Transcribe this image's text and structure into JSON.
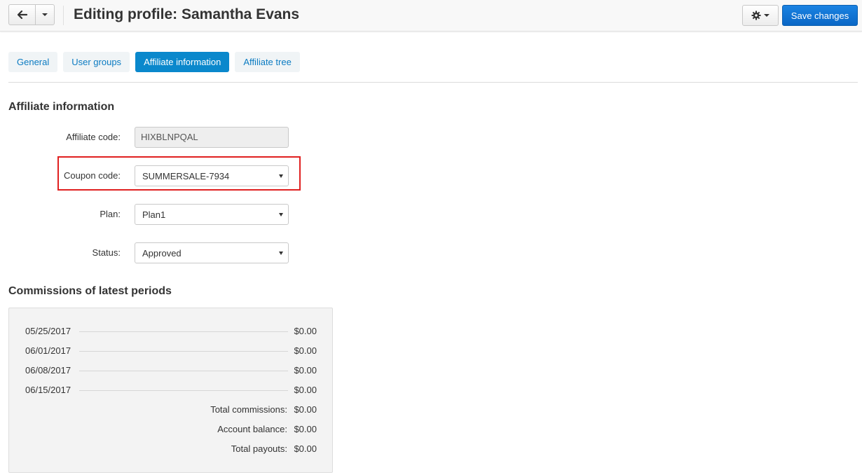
{
  "header": {
    "title": "Editing profile: Samantha Evans",
    "save_label": "Save changes"
  },
  "tabs": [
    {
      "label": "General",
      "active": false
    },
    {
      "label": "User groups",
      "active": false
    },
    {
      "label": "Affiliate information",
      "active": true
    },
    {
      "label": "Affiliate tree",
      "active": false
    }
  ],
  "affiliate": {
    "section_title": "Affiliate information",
    "code_label": "Affiliate code:",
    "code_value": "HIXBLNPQAL",
    "coupon_label": "Coupon code:",
    "coupon_value": "SUMMERSALE-7934",
    "plan_label": "Plan:",
    "plan_value": "Plan1",
    "status_label": "Status:",
    "status_value": "Approved"
  },
  "commissions": {
    "section_title": "Commissions of latest periods",
    "periods": [
      {
        "date": "05/25/2017",
        "value": "$0.00"
      },
      {
        "date": "06/01/2017",
        "value": "$0.00"
      },
      {
        "date": "06/08/2017",
        "value": "$0.00"
      },
      {
        "date": "06/15/2017",
        "value": "$0.00"
      }
    ],
    "totals": [
      {
        "label": "Total commissions:",
        "value": "$0.00"
      },
      {
        "label": "Account balance:",
        "value": "$0.00"
      },
      {
        "label": "Total payouts:",
        "value": "$0.00"
      }
    ]
  },
  "colors": {
    "primary": "#0a67c6",
    "tab_active": "#0a88cc",
    "tab_text": "#0b7bc2",
    "highlight": "#e02020"
  },
  "icons": {
    "back": "arrow-left-icon",
    "caret": "caret-down-icon",
    "settings": "gear-icon"
  }
}
